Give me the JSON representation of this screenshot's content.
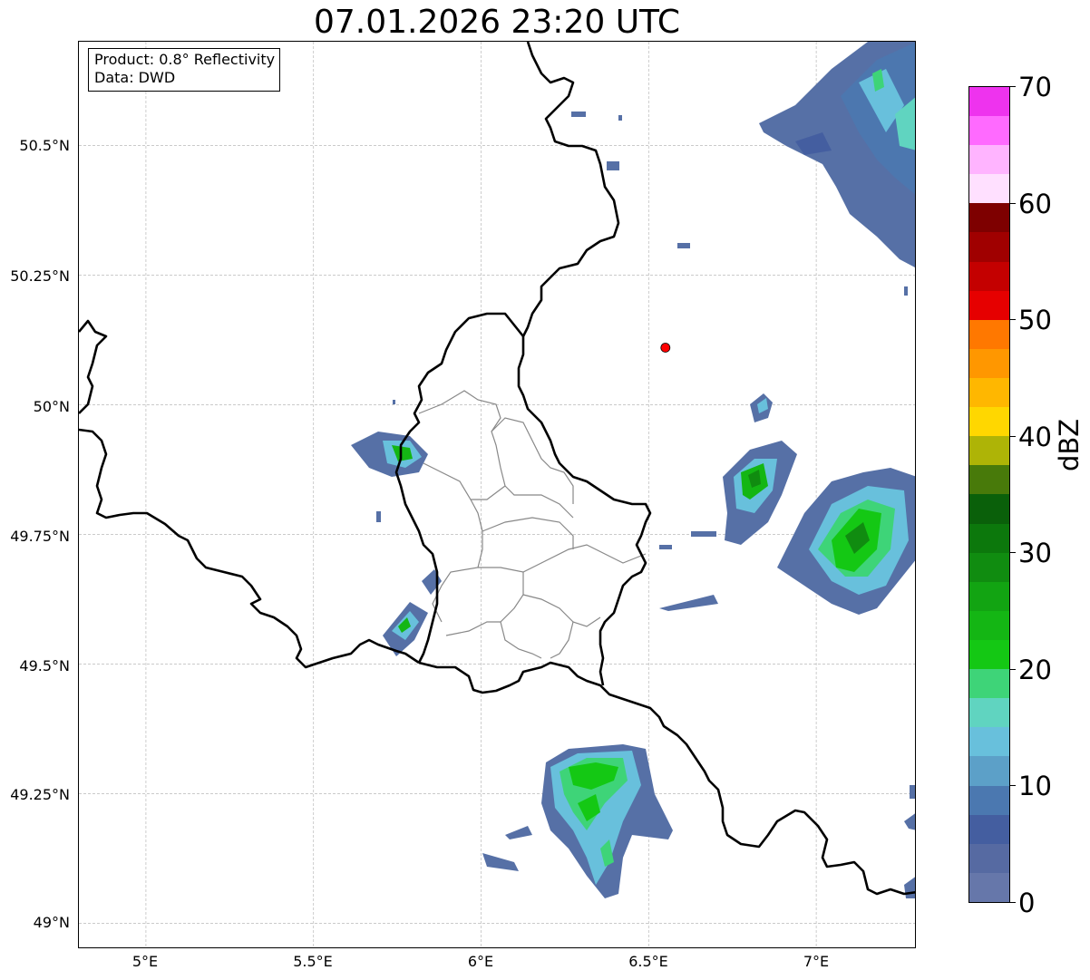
{
  "title": "07.01.2026 23:20 UTC",
  "info_box": {
    "product": "Product: 0.8° Reflectivity",
    "data_source": "Data: DWD"
  },
  "map": {
    "type": "radar-reflectivity-map",
    "extent": {
      "lon_min": 4.8,
      "lon_max": 7.3,
      "lat_min": 48.95,
      "lat_max": 50.7
    },
    "gridlines": true,
    "lat_ticks": [
      {
        "value": 50.5,
        "label": "50.5°N"
      },
      {
        "value": 50.25,
        "label": "50.25°N"
      },
      {
        "value": 50.0,
        "label": "50°N"
      },
      {
        "value": 49.75,
        "label": "49.75°N"
      },
      {
        "value": 49.5,
        "label": "49.5°N"
      },
      {
        "value": 49.25,
        "label": "49.25°N"
      },
      {
        "value": 49.0,
        "label": "49°N"
      }
    ],
    "lon_ticks": [
      {
        "value": 5.0,
        "label": "5°E"
      },
      {
        "value": 5.5,
        "label": "5.5°E"
      },
      {
        "value": 6.0,
        "label": "6°E"
      },
      {
        "value": 6.5,
        "label": "6.5°E"
      },
      {
        "value": 7.0,
        "label": "7°E"
      }
    ],
    "marker": {
      "lon": 6.55,
      "lat": 50.11,
      "color": "#ff0000"
    }
  },
  "colorbar": {
    "label": "dBZ",
    "min": 0,
    "max": 70,
    "tick_labels": [
      "0",
      "10",
      "20",
      "30",
      "40",
      "50",
      "60",
      "70"
    ],
    "colors": [
      "#6677aa",
      "#566aa2",
      "#445ea0",
      "#4b78b0",
      "#5ca0c8",
      "#68c0dc",
      "#60d4c0",
      "#3ed478",
      "#14c814",
      "#14b614",
      "#12a412",
      "#108c10",
      "#0c780c",
      "#0a600a",
      "#487a0a",
      "#aeb406",
      "#ffd700",
      "#ffb700",
      "#ff9700",
      "#ff7800",
      "#e60000",
      "#c40000",
      "#a00000",
      "#7e0000",
      "#ffe0ff",
      "#ffb4ff",
      "#ff6aff",
      "#ee33ee"
    ]
  }
}
